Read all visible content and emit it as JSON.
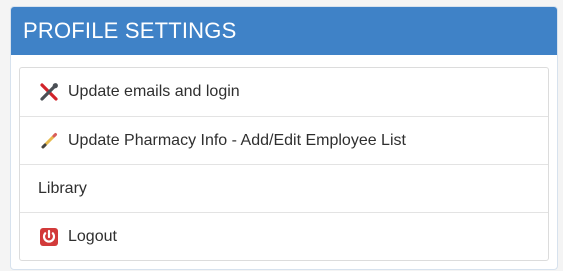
{
  "panel": {
    "title": "PROFILE SETTINGS",
    "colors": {
      "header_bg": "#3f82c7",
      "header_text": "#ffffff",
      "item_text": "#2f2f2f"
    }
  },
  "items": [
    {
      "label": "Update emails and login",
      "icon": "tools-icon"
    },
    {
      "label": "Update Pharmacy Info - Add/Edit Employee List",
      "icon": "pencil-icon"
    },
    {
      "label": "Library",
      "icon": ""
    },
    {
      "label": "Logout",
      "icon": "power-icon"
    }
  ]
}
